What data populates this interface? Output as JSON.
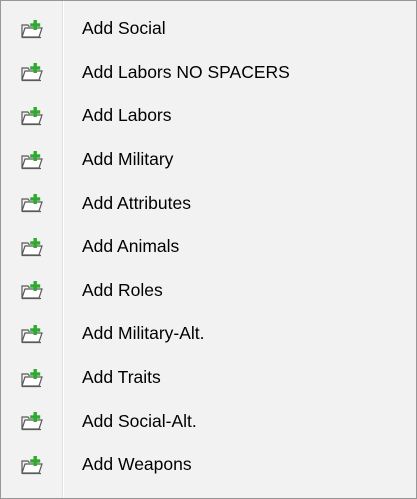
{
  "menu": {
    "items": [
      {
        "label": "Add Social",
        "icon": "add-folder-icon"
      },
      {
        "label": "Add Labors NO SPACERS",
        "icon": "add-folder-icon"
      },
      {
        "label": "Add Labors",
        "icon": "add-folder-icon"
      },
      {
        "label": "Add Military",
        "icon": "add-folder-icon"
      },
      {
        "label": "Add Attributes",
        "icon": "add-folder-icon"
      },
      {
        "label": "Add Animals",
        "icon": "add-folder-icon"
      },
      {
        "label": "Add Roles",
        "icon": "add-folder-icon"
      },
      {
        "label": "Add Military-Alt.",
        "icon": "add-folder-icon"
      },
      {
        "label": "Add Traits",
        "icon": "add-folder-icon"
      },
      {
        "label": "Add Social-Alt.",
        "icon": "add-folder-icon"
      },
      {
        "label": "Add Weapons",
        "icon": "add-folder-icon"
      }
    ],
    "colors": {
      "background": "#f2f2f2",
      "border": "#979797",
      "icon_plus": "#2eaa2e",
      "icon_outline": "#5a5a5a"
    }
  }
}
